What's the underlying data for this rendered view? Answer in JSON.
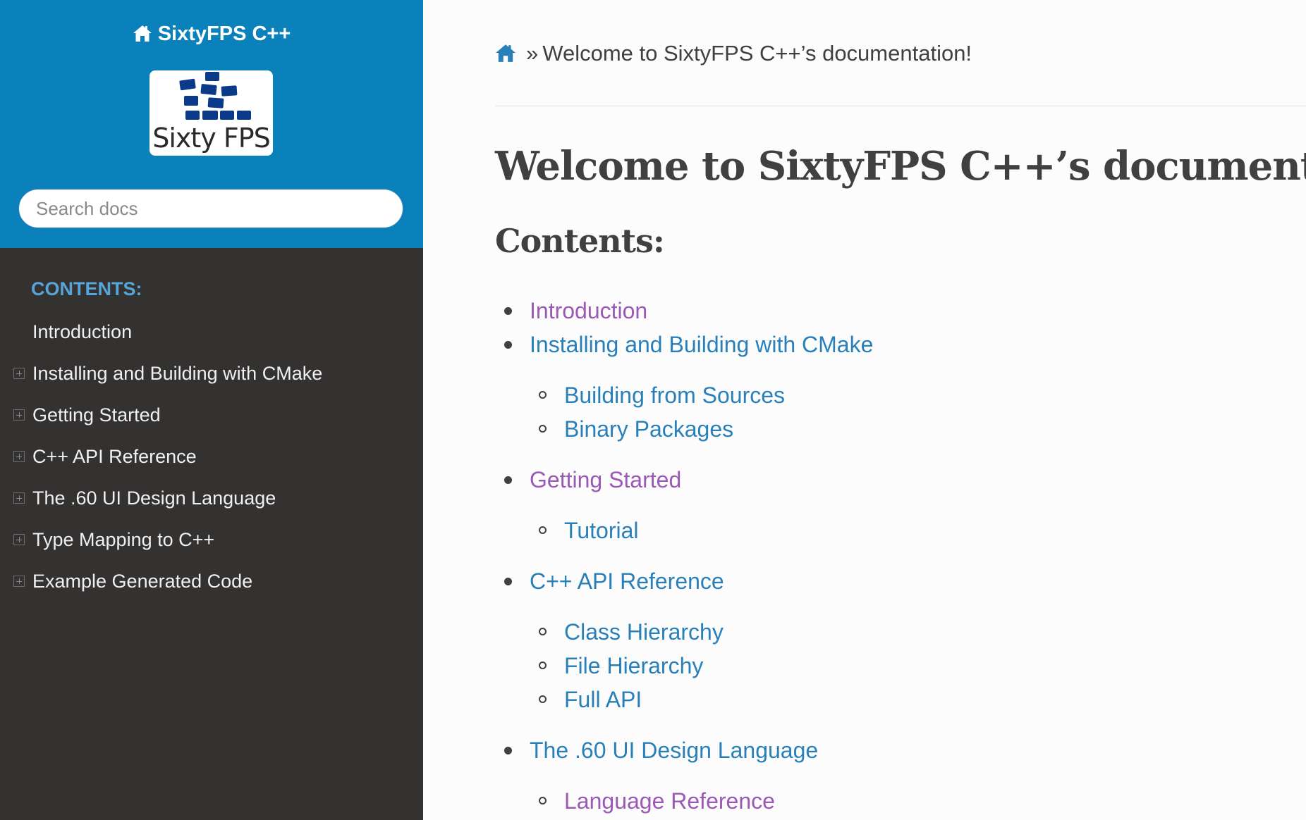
{
  "sidebar": {
    "project_name": "SixtyFPS C++",
    "logo_text": "Sixty FPS",
    "search_placeholder": "Search docs",
    "caption": "CONTENTS:",
    "items": [
      {
        "label": "Introduction",
        "expandable": false
      },
      {
        "label": "Installing and Building with CMake",
        "expandable": true
      },
      {
        "label": "Getting Started",
        "expandable": true
      },
      {
        "label": "C++ API Reference",
        "expandable": true
      },
      {
        "label": "The .60 UI Design Language",
        "expandable": true
      },
      {
        "label": "Type Mapping to C++",
        "expandable": true
      },
      {
        "label": "Example Generated Code",
        "expandable": true
      }
    ]
  },
  "breadcrumb": {
    "separator": "»",
    "current": "Welcome to SixtyFPS C++’s documentation!"
  },
  "main": {
    "title": "Welcome to SixtyFPS C++’s documentation!",
    "contents_heading": "Contents:",
    "toc": [
      {
        "label": "Introduction",
        "visited": true,
        "children": []
      },
      {
        "label": "Installing and Building with CMake",
        "visited": false,
        "children": [
          {
            "label": "Building from Sources",
            "visited": false
          },
          {
            "label": "Binary Packages",
            "visited": false
          }
        ]
      },
      {
        "label": "Getting Started",
        "visited": true,
        "children": [
          {
            "label": "Tutorial",
            "visited": false
          }
        ]
      },
      {
        "label": "C++ API Reference",
        "visited": false,
        "children": [
          {
            "label": "Class Hierarchy",
            "visited": false
          },
          {
            "label": "File Hierarchy",
            "visited": false
          },
          {
            "label": "Full API",
            "visited": false
          }
        ]
      },
      {
        "label": "The .60 UI Design Language",
        "visited": false,
        "children": [
          {
            "label": "Language Reference",
            "visited": true
          }
        ]
      }
    ]
  },
  "colors": {
    "sidebar_header": "#0a81bb",
    "sidebar_body": "#343131",
    "caption": "#55a5d9",
    "link": "#2980b9",
    "link_visited": "#9b59b6",
    "text": "#404040"
  }
}
